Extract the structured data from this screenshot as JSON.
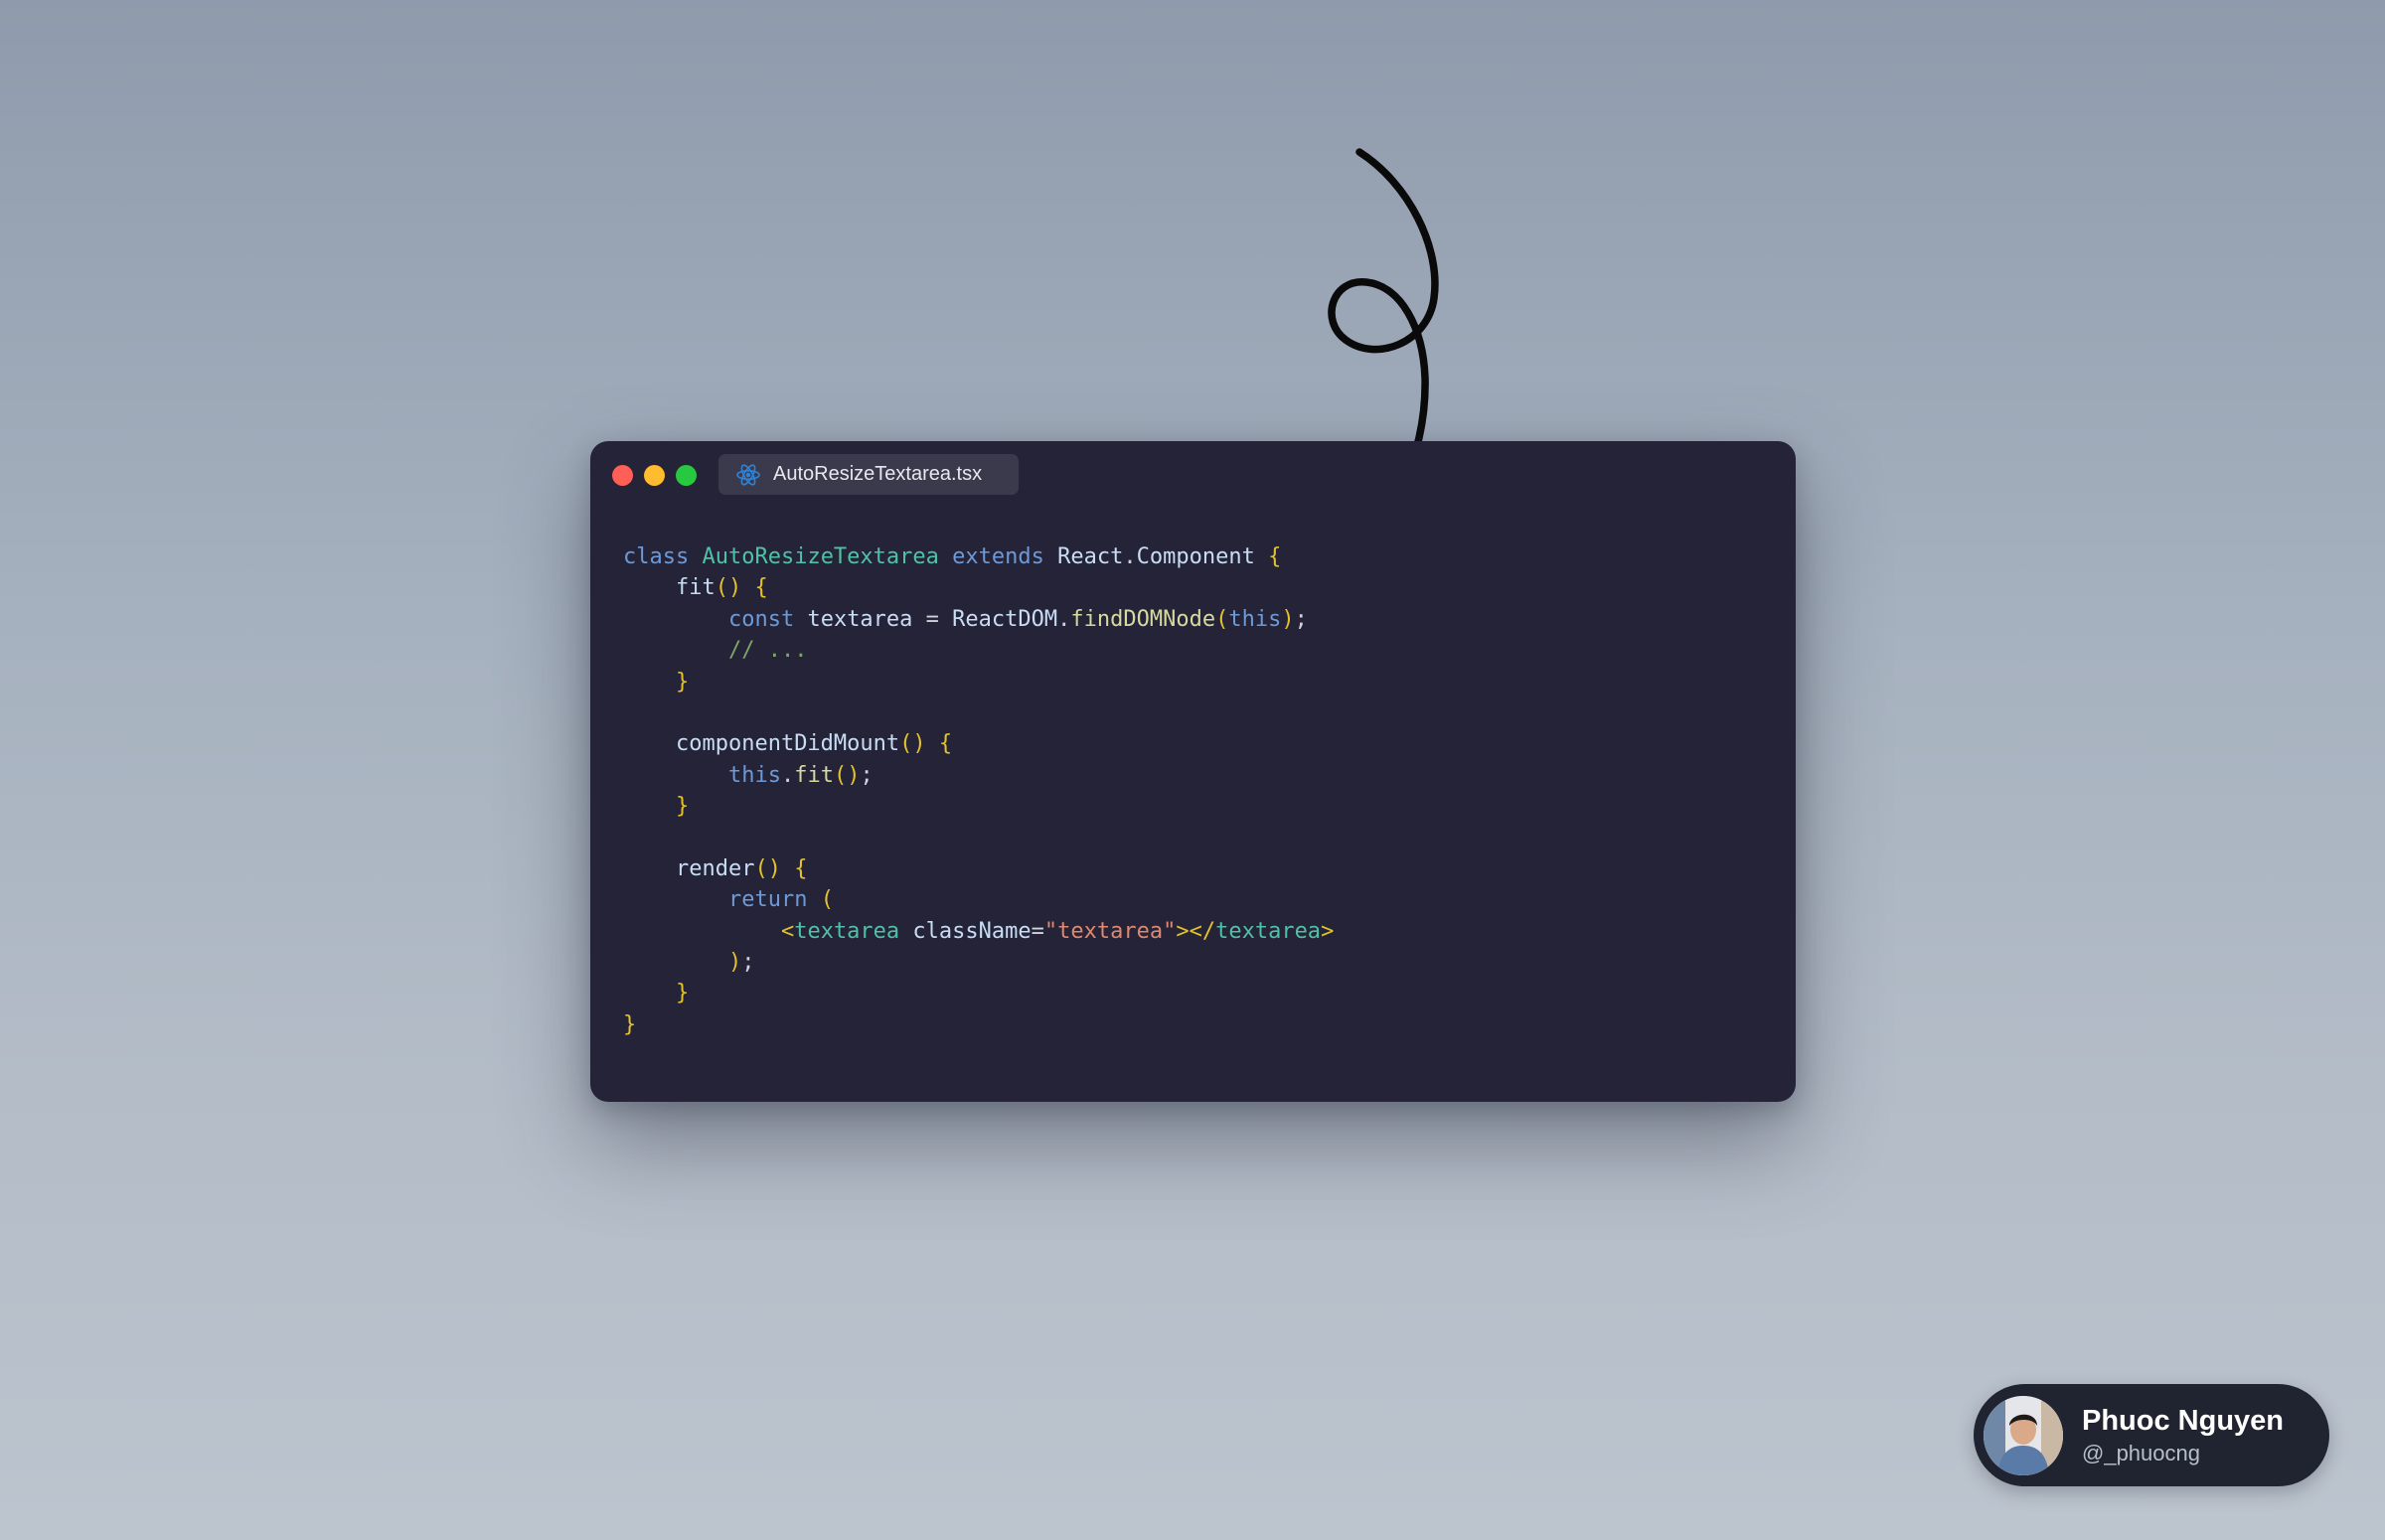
{
  "editor": {
    "tab": {
      "filename": "AutoResizeTextarea.tsx",
      "icon": "react-icon"
    },
    "traffic_lights": {
      "close_color": "#fe5f57",
      "minimize_color": "#febc2e",
      "zoom_color": "#28c840"
    },
    "code": {
      "t1": "class",
      "t2": "AutoResizeTextarea",
      "t3": "extends",
      "t4": "React",
      "t5": "Component",
      "t6": "fit",
      "t7": "const",
      "t8": "textarea",
      "t9": "ReactDOM",
      "t10": "findDOMNode",
      "t11": "this",
      "t12": "// ...",
      "t13": "componentDidMount",
      "t14": "this",
      "t15": "fit",
      "t16": "render",
      "t17": "return",
      "t18": "textarea",
      "t19": "className",
      "t20": "\"textarea\"",
      "t21": "textarea"
    }
  },
  "annotation": {
    "icon": "curly-arrow-icon"
  },
  "profile": {
    "name": "Phuoc Nguyen",
    "handle": "@_phuocng"
  },
  "colors": {
    "background_top": "#8f9bac",
    "background_bottom": "#bcc4ce",
    "editor_background": "#252337",
    "profile_background": "#1f2430"
  }
}
